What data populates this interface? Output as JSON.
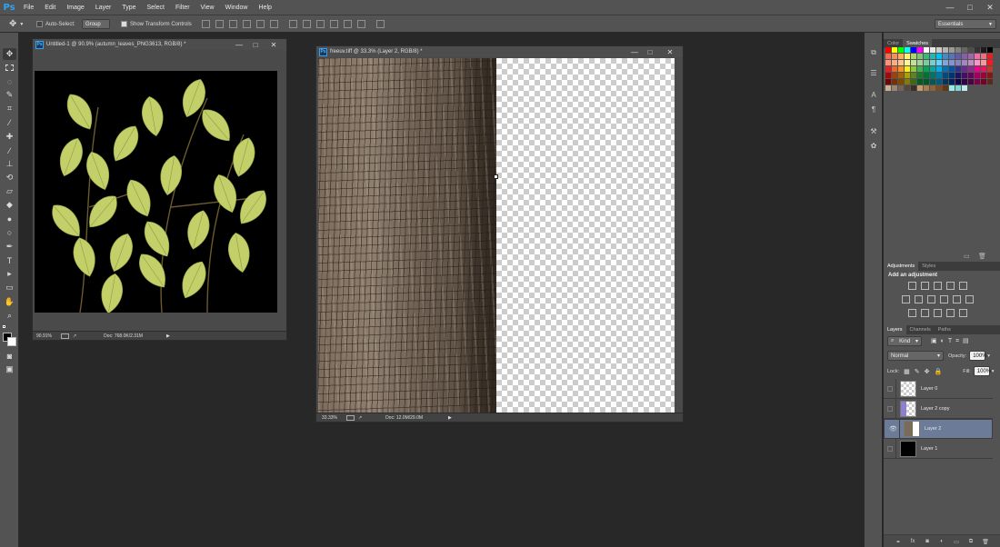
{
  "app": {
    "logo": "Ps"
  },
  "menu": [
    "File",
    "Edit",
    "Image",
    "Layer",
    "Type",
    "Select",
    "Filter",
    "View",
    "Window",
    "Help"
  ],
  "window_controls": [
    "—",
    "□",
    "✕"
  ],
  "options_bar": {
    "auto_select_label": "Auto-Select:",
    "auto_select_value": "Group",
    "show_transform_label": "Show Transform Controls",
    "workspace": "Essentials"
  },
  "doc1": {
    "title": "Untitled-1 @ 90.9% (autumn_leaves_PNG3613, RGB/8) *",
    "zoom": "90.91%",
    "doc_size": "Doc: 768.0K/2.31M"
  },
  "doc2": {
    "title": "freeuv.tiff @ 33.3% (Layer 2, RGB/8) *",
    "zoom": "33.33%",
    "doc_size": "Doc: 12.0M/29.0M"
  },
  "color_panel": {
    "tabs": [
      "Color",
      "Swatches"
    ],
    "active": "Swatches"
  },
  "adjustments_panel": {
    "tabs": [
      "Adjustments",
      "Styles"
    ],
    "title": "Add an adjustment"
  },
  "layers_panel": {
    "tabs": [
      "Layers",
      "Channels",
      "Paths"
    ],
    "filter_kind": "Kind",
    "blend_mode": "Normal",
    "opacity_label": "Opacity:",
    "opacity": "100%",
    "lock_label": "Lock:",
    "fill_label": "Fill:",
    "fill": "100%",
    "layers": [
      {
        "name": "Layer 0",
        "visible": false,
        "selected": false,
        "thumb": "checker"
      },
      {
        "name": "Layer 2 copy",
        "visible": false,
        "selected": false,
        "thumb": "blue-checker"
      },
      {
        "name": "Layer 2",
        "visible": true,
        "selected": true,
        "thumb": "bark"
      },
      {
        "name": "Layer 1",
        "visible": false,
        "selected": false,
        "thumb": "black"
      }
    ]
  },
  "colors": {
    "chrome": "#535353",
    "workspace": "#282828",
    "selected_layer": "#6b7b98",
    "ps_blue": "#2fa3f7",
    "leaf": "#c6d36a"
  }
}
